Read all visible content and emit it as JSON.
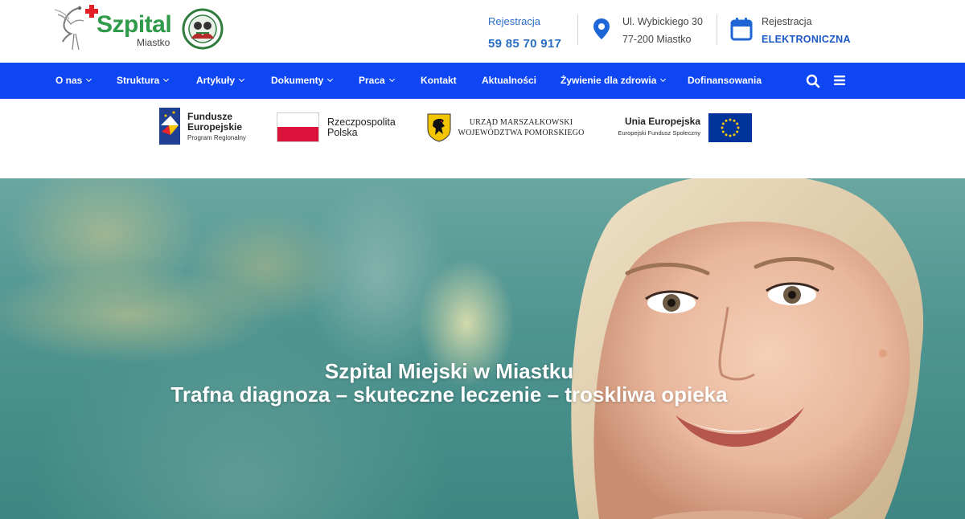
{
  "header": {
    "logo": {
      "name": "Szpital",
      "subtitle": "Miastko"
    },
    "registration": {
      "label": "Rejestracja",
      "phone": "59 85 70 917"
    },
    "address": {
      "line1": "Ul. Wybickiego 30",
      "line2": "77-200 Miastko"
    },
    "e_registration": {
      "line1": "Rejestracja",
      "line2": "ELEKTRONICZNA"
    }
  },
  "nav": {
    "items": [
      {
        "label": "O nas",
        "dropdown": true
      },
      {
        "label": "Struktura",
        "dropdown": true
      },
      {
        "label": "Artykuły",
        "dropdown": true
      },
      {
        "label": "Dokumenty",
        "dropdown": true
      },
      {
        "label": "Praca",
        "dropdown": true
      },
      {
        "label": "Kontakt",
        "dropdown": false
      },
      {
        "label": "Aktualności",
        "dropdown": false
      },
      {
        "label": "Żywienie dla zdrowia",
        "dropdown": true
      },
      {
        "label": "Dofinansowania",
        "dropdown": false
      }
    ],
    "search_icon": "search-icon",
    "menu_icon": "hamburger-menu-icon"
  },
  "sponsors": {
    "fe": {
      "line1": "Fundusze",
      "line2": "Europejskie",
      "line3": "Program Regionalny"
    },
    "rp": {
      "line1": "Rzeczpospolita",
      "line2": "Polska"
    },
    "um": {
      "line1": "URZĄD MARSZAŁKOWSKI",
      "line2": "WOJEWÓDZTWA POMORSKIEGO"
    },
    "ue": {
      "line1": "Unia Europejska",
      "line2": "Europejski Fundusz Społeczny"
    }
  },
  "hero": {
    "title": "Szpital Miejski w Miastku",
    "tagline": "Trafna diagnoza – skuteczne leczenie – troskliwa opieka"
  },
  "colors": {
    "nav_bg": "#0d46f2",
    "brand_green": "#2e9a4a",
    "accent_blue": "#2b6fc4",
    "cross_red": "#e41e26"
  }
}
